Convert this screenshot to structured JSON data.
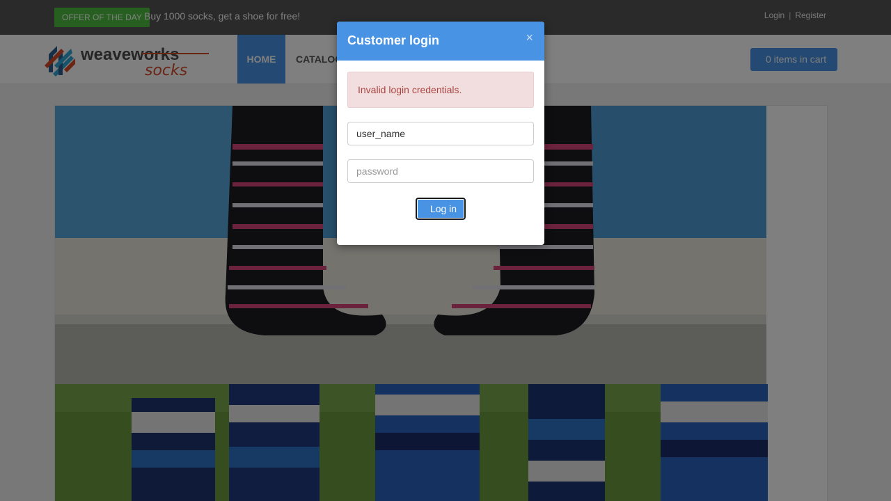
{
  "topbar": {
    "offer_badge": "OFFER OF THE DAY",
    "offer_text": "Buy 1000 socks, get a shoe for free!",
    "login_link": "Login",
    "separator": "|",
    "register_link": "Register"
  },
  "navbar": {
    "logo_text_primary": "weaveworks",
    "logo_text_secondary": "socks",
    "home": "HOME",
    "catalog": "CATALOG",
    "cart": "0 items in cart"
  },
  "modal": {
    "title": "Customer login",
    "close": "×",
    "alert": "Invalid login credentials.",
    "username_value": "user_name",
    "password_placeholder": "password",
    "login_button": "Log in"
  },
  "colors": {
    "primary": "#4993e4",
    "offer_green": "#4fbf40",
    "alert_text": "#a94442",
    "alert_bg": "#f2dede"
  },
  "icons": [
    "close-icon",
    "cart-icon",
    "weaveworks-logo"
  ]
}
